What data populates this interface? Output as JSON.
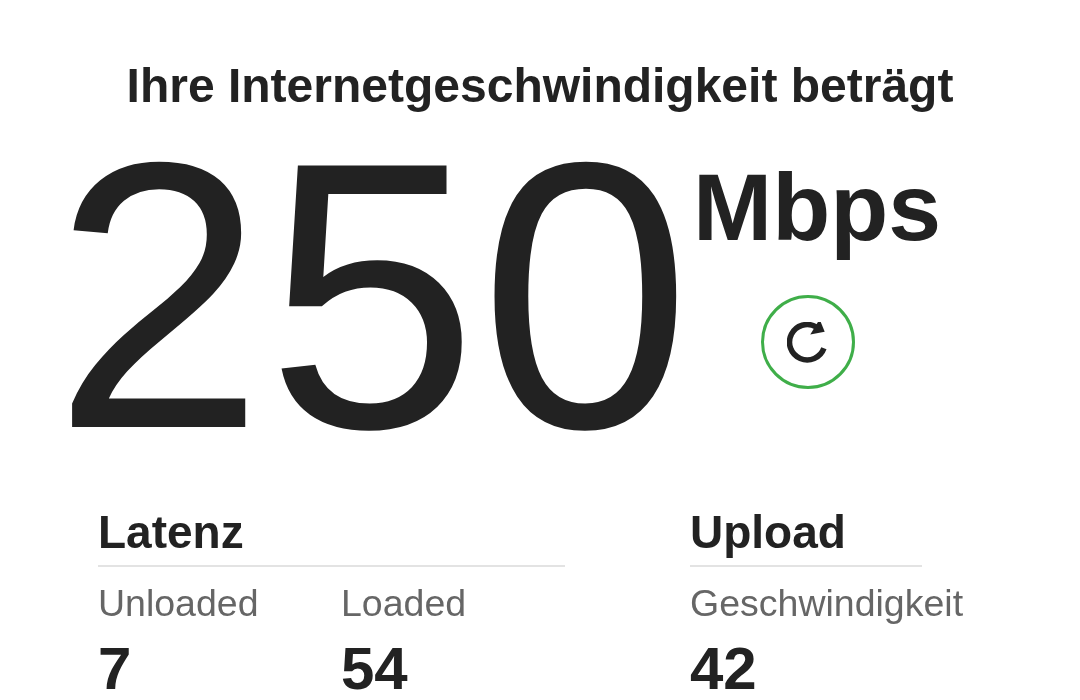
{
  "heading": "Ihre Internetgeschwindigkeit beträgt",
  "speed": {
    "value": "250",
    "unit": "Mbps"
  },
  "sections": [
    {
      "title": "Latenz",
      "metrics": [
        {
          "label": "Unloaded",
          "value": "7"
        },
        {
          "label": "Loaded",
          "value": "54"
        }
      ]
    },
    {
      "title": "Upload",
      "metrics": [
        {
          "label": "Geschwindigkeit",
          "value": "42"
        }
      ]
    }
  ]
}
